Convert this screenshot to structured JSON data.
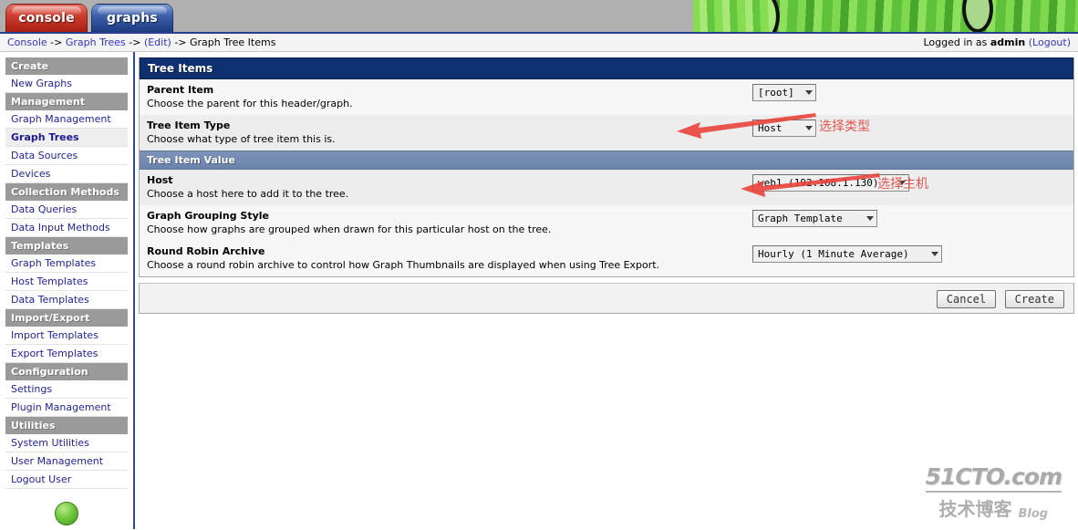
{
  "app": {
    "tabs": [
      {
        "label": "console",
        "active": false
      },
      {
        "label": "graphs",
        "active": true
      }
    ]
  },
  "breadcrumb": {
    "items": [
      "Console",
      "Graph Trees",
      "(Edit)",
      "Graph Tree Items"
    ],
    "separator": "->",
    "login_prefix": "Logged in as",
    "login_user": "admin",
    "logout_label": "(Logout)"
  },
  "sidebar": {
    "groups": [
      {
        "header": "Create",
        "items": [
          {
            "label": "New Graphs",
            "selected": false
          }
        ]
      },
      {
        "header": "Management",
        "items": [
          {
            "label": "Graph Management",
            "selected": false
          },
          {
            "label": "Graph Trees",
            "selected": true
          },
          {
            "label": "Data Sources",
            "selected": false
          },
          {
            "label": "Devices",
            "selected": false
          }
        ]
      },
      {
        "header": "Collection Methods",
        "items": [
          {
            "label": "Data Queries",
            "selected": false
          },
          {
            "label": "Data Input Methods",
            "selected": false
          }
        ]
      },
      {
        "header": "Templates",
        "items": [
          {
            "label": "Graph Templates",
            "selected": false
          },
          {
            "label": "Host Templates",
            "selected": false
          },
          {
            "label": "Data Templates",
            "selected": false
          }
        ]
      },
      {
        "header": "Import/Export",
        "items": [
          {
            "label": "Import Templates",
            "selected": false
          },
          {
            "label": "Export Templates",
            "selected": false
          }
        ]
      },
      {
        "header": "Configuration",
        "items": [
          {
            "label": "Settings",
            "selected": false
          },
          {
            "label": "Plugin Management",
            "selected": false
          }
        ]
      },
      {
        "header": "Utilities",
        "items": [
          {
            "label": "System Utilities",
            "selected": false
          },
          {
            "label": "User Management",
            "selected": false
          },
          {
            "label": "Logout User",
            "selected": false
          }
        ]
      }
    ]
  },
  "main": {
    "panel_title": "Tree Items",
    "section_title": "Tree Item Value",
    "fields": {
      "parent_item": {
        "name": "Parent Item",
        "desc": "Choose the parent for this header/graph.",
        "value": "[root]"
      },
      "tree_item_type": {
        "name": "Tree Item Type",
        "desc": "Choose what type of tree item this is.",
        "value": "Host"
      },
      "host": {
        "name": "Host",
        "desc": "Choose a host here to add it to the tree.",
        "value": "web1 (192.168.1.130)"
      },
      "graph_grouping_style": {
        "name": "Graph Grouping Style",
        "desc": "Choose how graphs are grouped when drawn for this particular host on the tree.",
        "value": "Graph Template"
      },
      "round_robin_archive": {
        "name": "Round Robin Archive",
        "desc": "Choose a round robin archive to control how Graph Thumbnails are displayed when using Tree Export.",
        "value": "Hourly (1 Minute Average)"
      }
    },
    "buttons": {
      "cancel": "Cancel",
      "create": "Create"
    }
  },
  "annotations": [
    {
      "text": "选择类型",
      "color": "#e0564f"
    },
    {
      "text": "选择主机",
      "color": "#e0564f"
    }
  ],
  "watermark": {
    "site": "51CTO.com",
    "tagline": "技术博客",
    "blog": "Blog"
  },
  "colors": {
    "tab_console": "#cf3f31",
    "tab_graphs": "#3f62ab",
    "panel_header": "#0f3070",
    "subhead": "#6b83ab",
    "nav_header": "#9a9a9a",
    "link": "#3333cc",
    "annotation": "#e0564f",
    "banner_bg": "#b0b0b0"
  }
}
